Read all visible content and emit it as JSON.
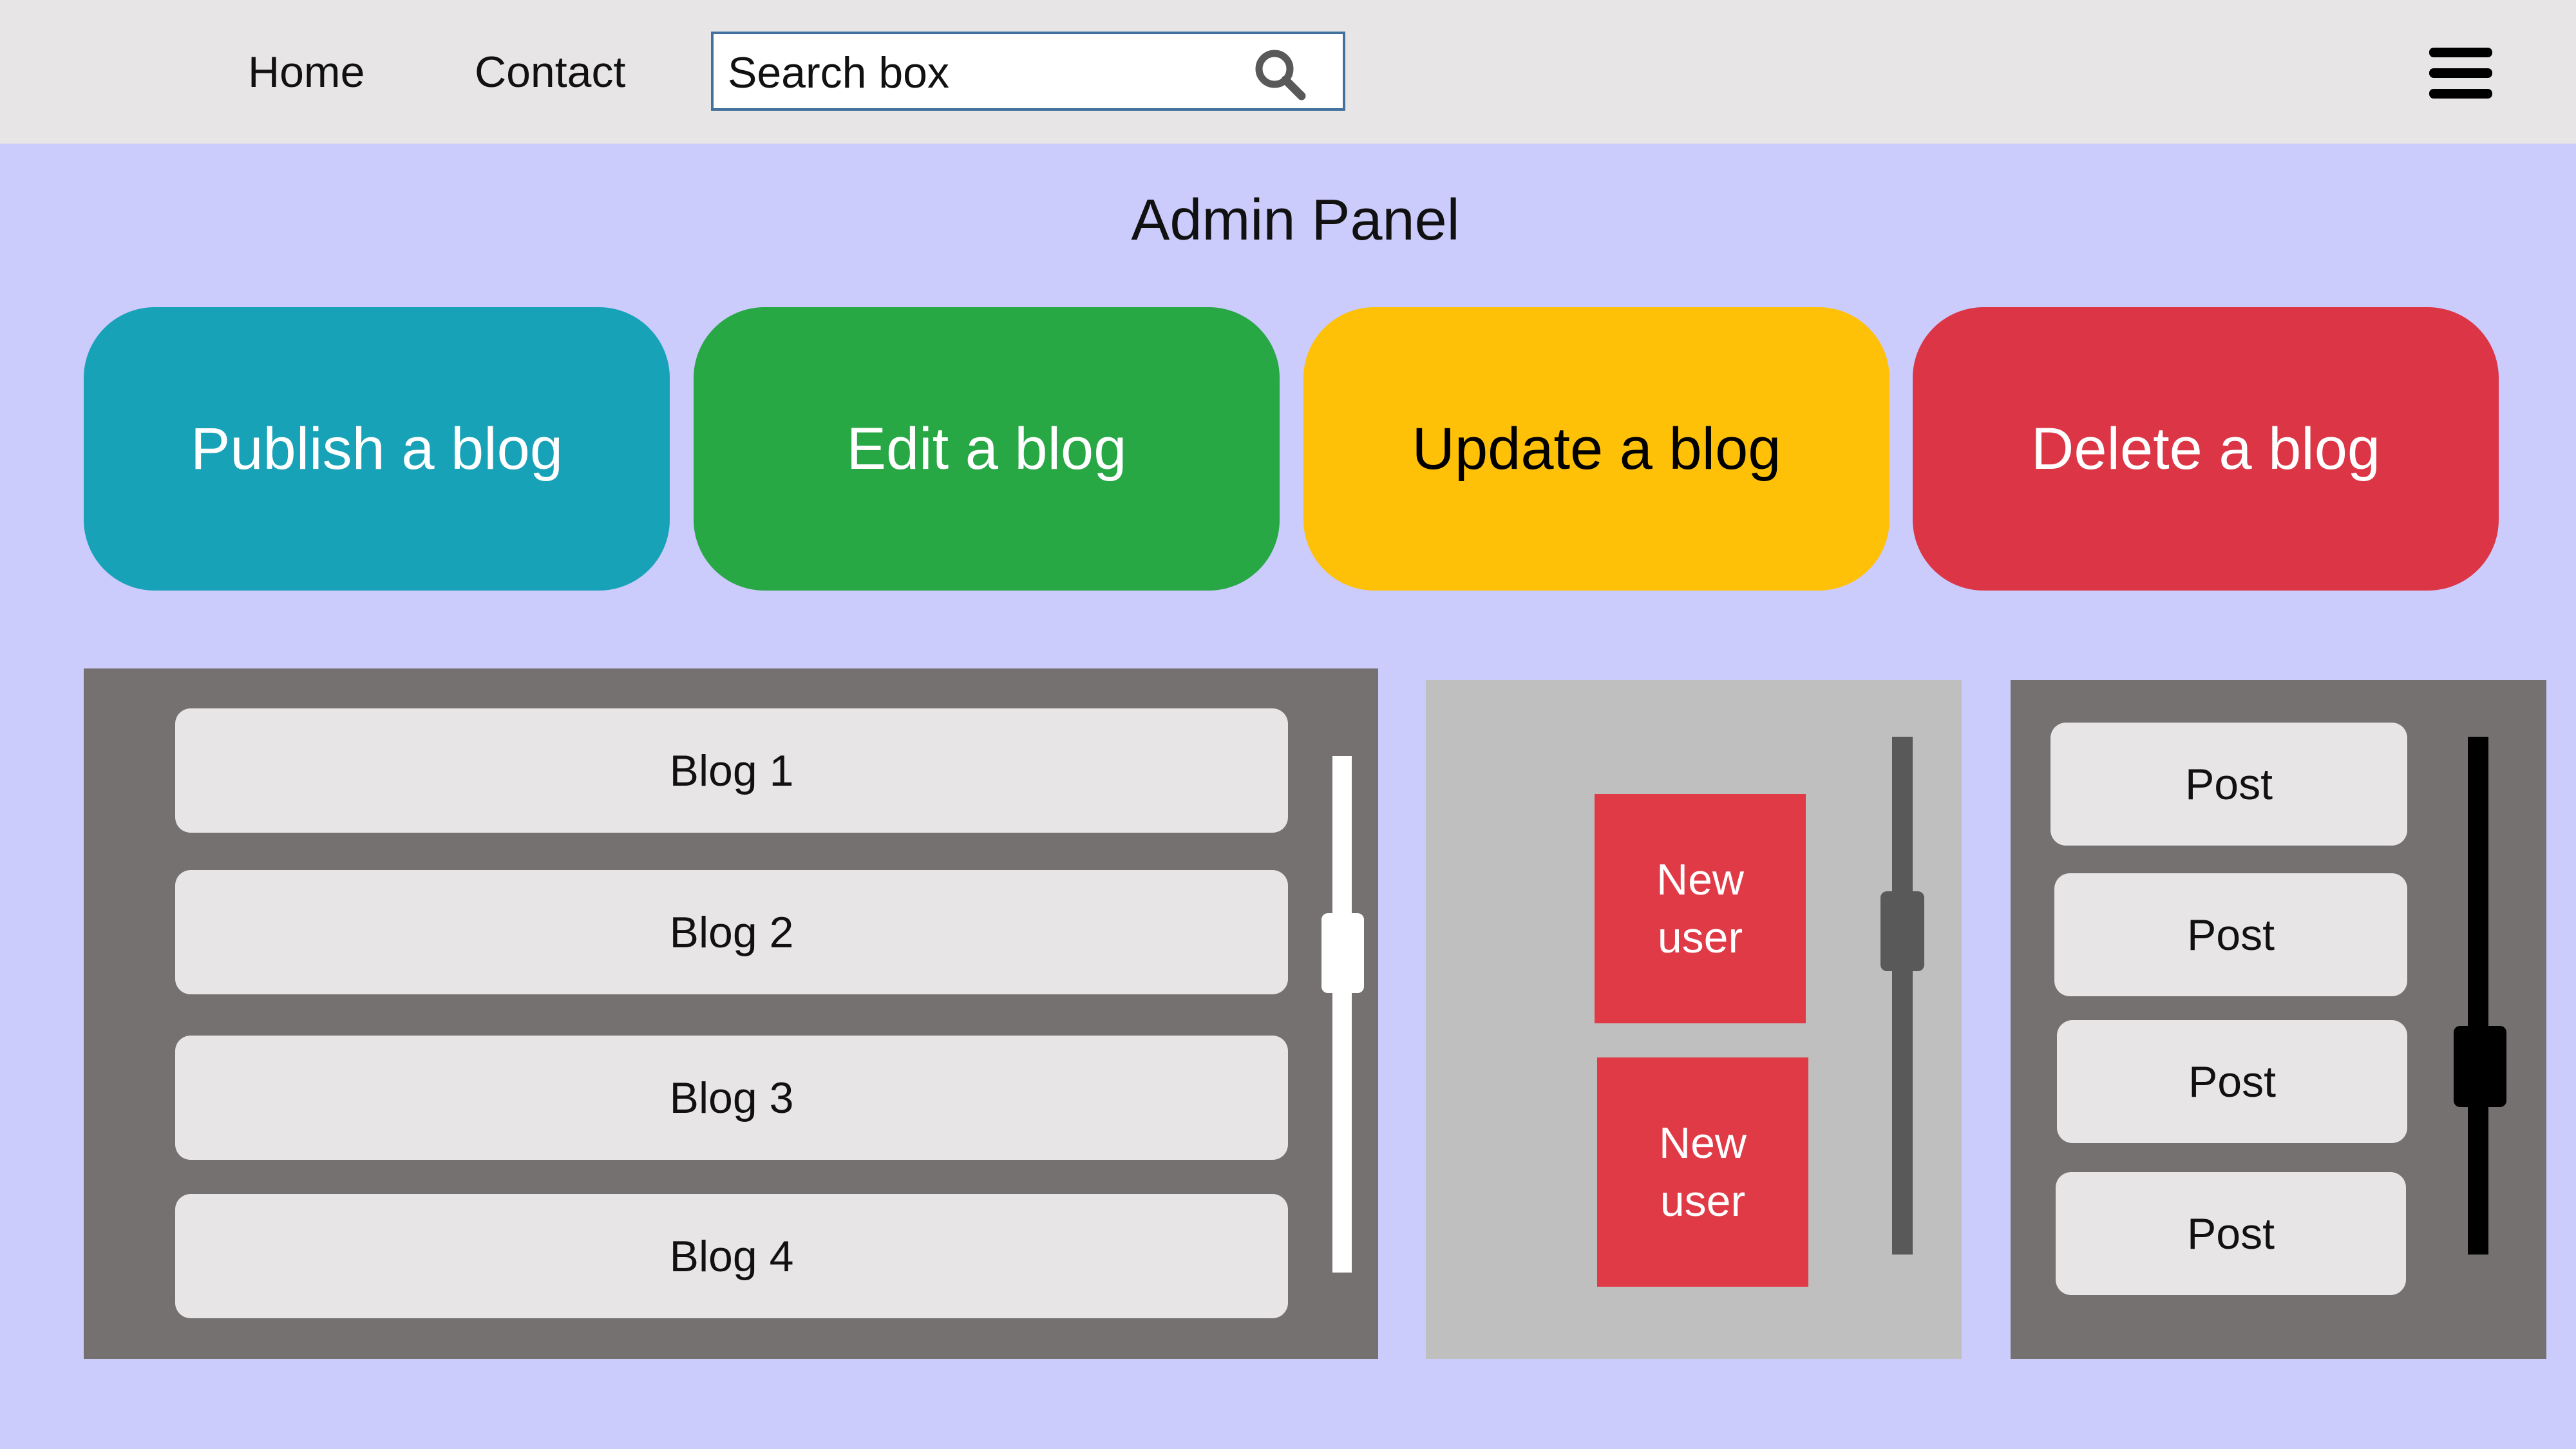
{
  "nav": {
    "home_label": "Home",
    "contact_label": "Contact",
    "search": {
      "placeholder": "Search box",
      "value": ""
    },
    "search_icon": "search-icon",
    "menu_icon": "hamburger-menu-icon"
  },
  "page": {
    "title": "Admin Panel"
  },
  "actions": {
    "publish_label": "Publish a blog",
    "edit_label": "Edit a blog",
    "update_label": "Update a blog",
    "delete_label": "Delete a blog"
  },
  "blogs": {
    "items": [
      {
        "label": "Blog 1"
      },
      {
        "label": "Blog 2"
      },
      {
        "label": "Blog 3"
      },
      {
        "label": "Blog 4"
      }
    ]
  },
  "users": {
    "items": [
      {
        "line1": "New",
        "line2": "user"
      },
      {
        "line1": "New",
        "line2": "user"
      }
    ]
  },
  "posts": {
    "items": [
      {
        "label": "Post"
      },
      {
        "label": "Post"
      },
      {
        "label": "Post"
      },
      {
        "label": "Post"
      }
    ]
  },
  "colors": {
    "background": "#cbcbfc",
    "navbar": "#e7e5e6",
    "publish": "#17a2b8",
    "edit": "#28a745",
    "update": "#ffc107",
    "delete": "#dc3545",
    "new_user": "#e03a47",
    "panel_dark": "#767171",
    "panel_light": "#bfbfbf"
  }
}
